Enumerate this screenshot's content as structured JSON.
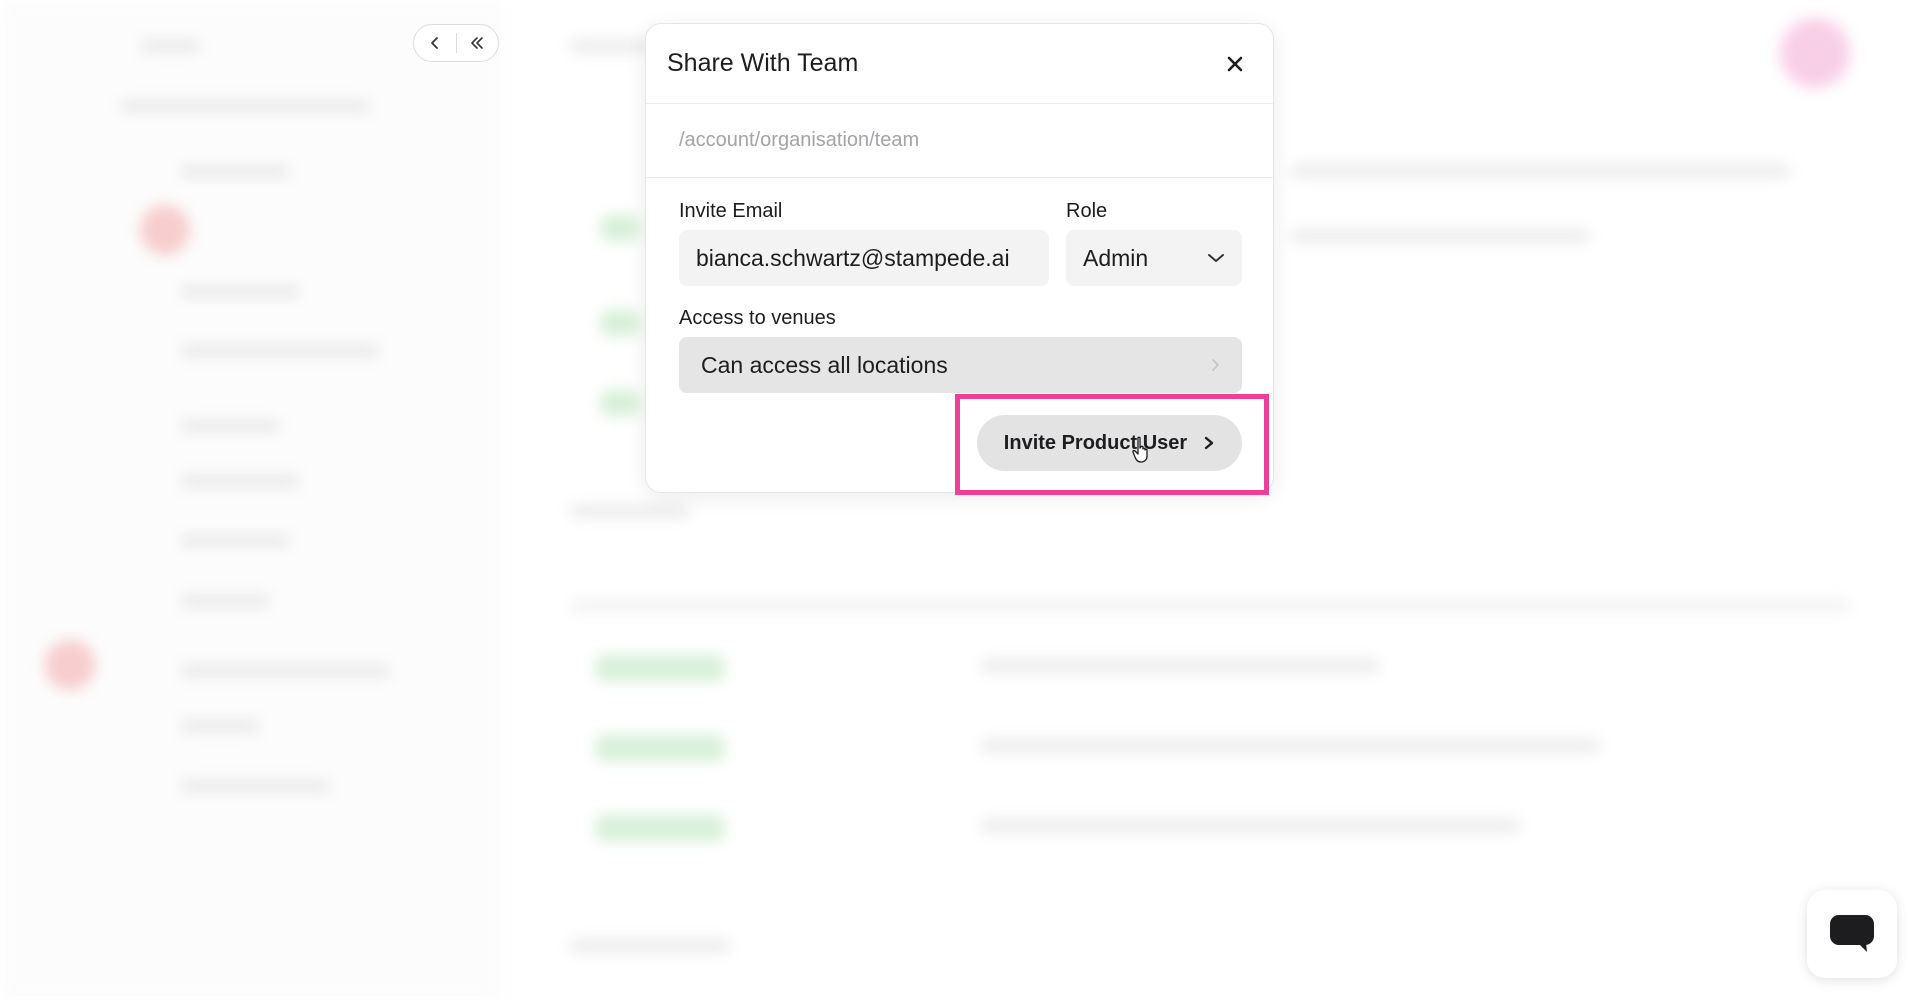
{
  "modal": {
    "title": "Share With Team",
    "path": "/account/organisation/team",
    "invite_email_label": "Invite Email",
    "invite_email_value": "bianca.schwartz@stampede.ai",
    "role_label": "Role",
    "role_value": "Admin",
    "venues_label": "Access to venues",
    "venues_value": "Can access all locations",
    "submit_label": "Invite Product User"
  },
  "nav": {
    "back_icon": "chevron-left-icon",
    "collapse_icon": "double-chevron-left-icon"
  },
  "colors": {
    "highlight": "#ec3f9b",
    "chat_icon": "#1d1d1f"
  }
}
